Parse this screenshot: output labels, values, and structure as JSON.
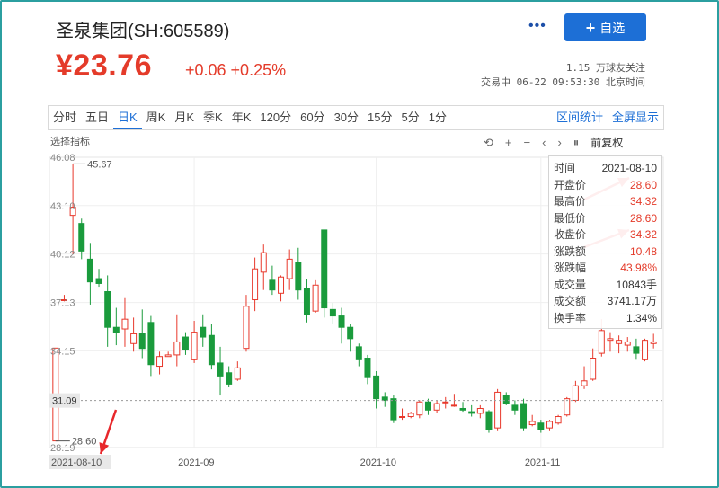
{
  "header": {
    "stock_name": "圣泉集团(SH:605589)",
    "more": "•••",
    "add_label": "自选",
    "price": "¥23.76",
    "change": "+0.06 +0.25%",
    "followers": "1.15 万球友关注",
    "trade_status": "交易中 06-22 09:53:30 北京时间"
  },
  "tabs": [
    "分时",
    "五日",
    "日K",
    "周K",
    "月K",
    "季K",
    "年K",
    "120分",
    "60分",
    "30分",
    "15分",
    "5分",
    "1分"
  ],
  "active_tab": "日K",
  "tab_actions": [
    "区间统计",
    "全屏显示"
  ],
  "toolbar": {
    "select_indicator": "选择指标",
    "undo": "⟲",
    "zoom_in": "+",
    "zoom_out": "−",
    "prev": "‹",
    "next": "›",
    "pause": "⏸",
    "adjust_mode": "前复权"
  },
  "tooltip": {
    "rows": [
      {
        "k": "时间",
        "v": "2021-08-10",
        "red": false
      },
      {
        "k": "开盘价",
        "v": "28.60",
        "red": true
      },
      {
        "k": "最高价",
        "v": "34.32",
        "red": true
      },
      {
        "k": "最低价",
        "v": "28.60",
        "red": true
      },
      {
        "k": "收盘价",
        "v": "34.32",
        "red": true
      },
      {
        "k": "涨跌额",
        "v": "10.48",
        "red": true
      },
      {
        "k": "涨跌幅",
        "v": "43.98%",
        "red": true
      },
      {
        "k": "成交量",
        "v": "10843手",
        "red": false
      },
      {
        "k": "成交额",
        "v": "3741.17万",
        "red": false
      },
      {
        "k": "换手率",
        "v": "1.34%",
        "red": false
      }
    ]
  },
  "colors": {
    "up": "#e8382b",
    "down": "#1a9b3c",
    "accent": "#1d6fd6",
    "frame": "#2b9fa0"
  },
  "chart_data": {
    "type": "candlestick",
    "y_ticks": [
      "46.08",
      "43.10",
      "40.12",
      "37.13",
      "34.15",
      "31.09",
      "28.19"
    ],
    "ylim": [
      28.19,
      46.08
    ],
    "crosshair_value": "31.09",
    "max_label": "45.67",
    "min_label": "28.60",
    "x_labels": [
      "2021-08-10",
      "2021-09",
      "2021-10",
      "2021-11"
    ],
    "candles": [
      [
        28.6,
        34.32,
        28.6,
        34.32
      ],
      [
        37.3,
        37.6,
        37.2,
        37.3
      ],
      [
        42.5,
        45.67,
        40.1,
        43.0
      ],
      [
        42.0,
        42.3,
        39.8,
        40.3
      ],
      [
        39.8,
        40.8,
        37.0,
        38.4
      ],
      [
        38.6,
        39.2,
        38.1,
        38.3
      ],
      [
        37.8,
        38.8,
        34.4,
        35.6
      ],
      [
        35.6,
        36.8,
        34.5,
        35.3
      ],
      [
        35.5,
        37.4,
        34.4,
        36.1
      ],
      [
        34.6,
        36.2,
        34.1,
        35.2
      ],
      [
        35.2,
        36.7,
        33.7,
        34.3
      ],
      [
        35.9,
        36.3,
        32.6,
        33.3
      ],
      [
        33.2,
        34.1,
        32.7,
        33.8
      ],
      [
        33.8,
        34.1,
        33.8,
        33.9
      ],
      [
        33.9,
        36.4,
        33.2,
        34.7
      ],
      [
        35.0,
        35.3,
        33.9,
        34.2
      ],
      [
        33.6,
        36.0,
        33.4,
        35.3
      ],
      [
        35.6,
        36.4,
        34.4,
        35.0
      ],
      [
        35.1,
        35.8,
        33.0,
        33.3
      ],
      [
        33.4,
        34.4,
        31.4,
        32.6
      ],
      [
        32.8,
        33.2,
        31.9,
        32.1
      ],
      [
        32.4,
        33.5,
        32.3,
        33.1
      ],
      [
        34.3,
        37.6,
        34.1,
        36.9
      ],
      [
        37.3,
        39.9,
        36.6,
        39.2
      ],
      [
        39.0,
        40.7,
        37.9,
        40.2
      ],
      [
        38.5,
        39.4,
        37.6,
        37.9
      ],
      [
        37.7,
        38.8,
        37.2,
        38.7
      ],
      [
        38.6,
        40.4,
        37.9,
        39.8
      ],
      [
        39.6,
        40.5,
        37.3,
        37.9
      ],
      [
        38.0,
        38.6,
        35.9,
        36.4
      ],
      [
        36.6,
        38.5,
        36.5,
        38.2
      ],
      [
        41.6,
        41.6,
        36.2,
        36.8
      ],
      [
        36.7,
        37.1,
        35.8,
        36.3
      ],
      [
        36.3,
        36.8,
        34.6,
        35.6
      ],
      [
        35.6,
        35.8,
        34.1,
        34.9
      ],
      [
        34.4,
        34.6,
        33.2,
        33.6
      ],
      [
        33.7,
        33.9,
        32.1,
        32.5
      ],
      [
        32.6,
        32.9,
        30.6,
        31.2
      ],
      [
        31.3,
        31.6,
        30.7,
        31.1
      ],
      [
        31.2,
        31.4,
        29.7,
        29.9
      ],
      [
        30.1,
        30.6,
        29.9,
        30.1
      ],
      [
        30.1,
        30.4,
        30.0,
        30.3
      ],
      [
        30.2,
        31.1,
        30.0,
        31.0
      ],
      [
        31.0,
        31.2,
        30.2,
        30.5
      ],
      [
        30.5,
        31.1,
        30.3,
        30.9
      ],
      [
        31.0,
        31.3,
        30.6,
        31.0
      ],
      [
        30.8,
        31.5,
        30.7,
        30.8
      ],
      [
        30.6,
        31.0,
        30.4,
        30.5
      ],
      [
        30.4,
        30.8,
        30.1,
        30.3
      ],
      [
        30.3,
        30.8,
        30.0,
        30.6
      ],
      [
        30.4,
        30.5,
        29.1,
        29.3
      ],
      [
        29.4,
        31.8,
        29.2,
        31.6
      ],
      [
        31.4,
        31.6,
        30.8,
        30.9
      ],
      [
        30.8,
        31.1,
        30.2,
        30.5
      ],
      [
        30.9,
        31.2,
        29.2,
        29.4
      ],
      [
        29.6,
        30.2,
        29.5,
        29.8
      ],
      [
        29.7,
        29.9,
        29.1,
        29.3
      ],
      [
        29.4,
        29.9,
        29.2,
        29.8
      ],
      [
        29.7,
        30.2,
        29.6,
        30.1
      ],
      [
        30.2,
        31.3,
        30.1,
        31.2
      ],
      [
        31.1,
        32.3,
        31.0,
        32.0
      ],
      [
        32.0,
        33.2,
        31.8,
        32.3
      ],
      [
        32.4,
        34.3,
        32.3,
        33.7
      ],
      [
        34.0,
        36.1,
        33.8,
        35.4
      ],
      [
        34.8,
        35.3,
        34.1,
        34.9
      ],
      [
        34.6,
        35.1,
        34.0,
        34.8
      ],
      [
        34.5,
        35.0,
        34.1,
        34.7
      ],
      [
        34.4,
        34.9,
        33.6,
        34.0
      ],
      [
        33.6,
        34.9,
        33.5,
        34.8
      ],
      [
        34.6,
        35.2,
        34.3,
        34.7
      ]
    ]
  }
}
